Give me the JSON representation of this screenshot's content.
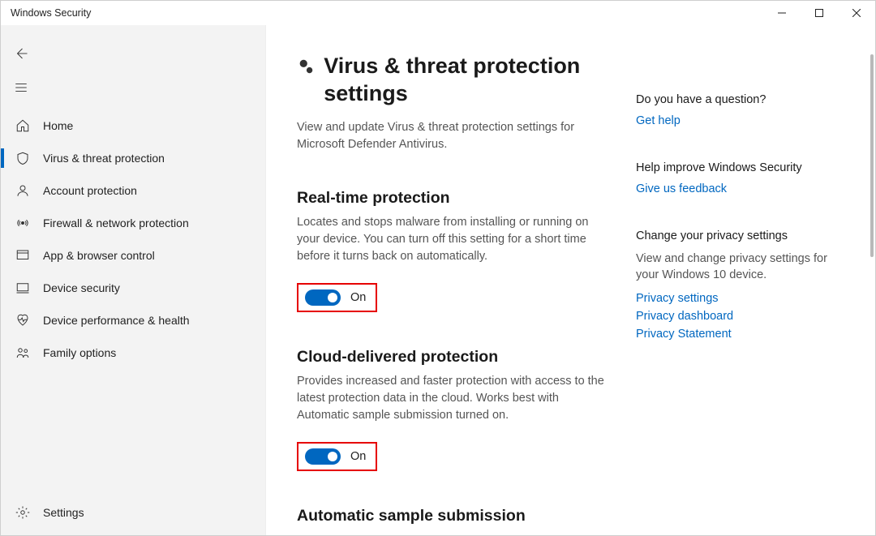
{
  "window": {
    "title": "Windows Security"
  },
  "sidebar": {
    "items": [
      {
        "label": "Home"
      },
      {
        "label": "Virus & threat protection"
      },
      {
        "label": "Account protection"
      },
      {
        "label": "Firewall & network protection"
      },
      {
        "label": "App & browser control"
      },
      {
        "label": "Device security"
      },
      {
        "label": "Device performance & health"
      },
      {
        "label": "Family options"
      }
    ],
    "settings_label": "Settings"
  },
  "page": {
    "title": "Virus & threat protection settings",
    "subtitle": "View and update Virus & threat protection settings for Microsoft Defender Antivirus."
  },
  "sections": {
    "realtime": {
      "title": "Real-time protection",
      "desc": "Locates and stops malware from installing or running on your device. You can turn off this setting for a short time before it turns back on automatically.",
      "state": "On"
    },
    "cloud": {
      "title": "Cloud-delivered protection",
      "desc": "Provides increased and faster protection with access to the latest protection data in the cloud. Works best with Automatic sample submission turned on.",
      "state": "On"
    },
    "auto_sample": {
      "title": "Automatic sample submission"
    }
  },
  "right": {
    "question": {
      "heading": "Do you have a question?",
      "link": "Get help"
    },
    "improve": {
      "heading": "Help improve Windows Security",
      "link": "Give us feedback"
    },
    "privacy": {
      "heading": "Change your privacy settings",
      "desc": "View and change privacy settings for your Windows 10 device.",
      "links": [
        "Privacy settings",
        "Privacy dashboard",
        "Privacy Statement"
      ]
    }
  }
}
